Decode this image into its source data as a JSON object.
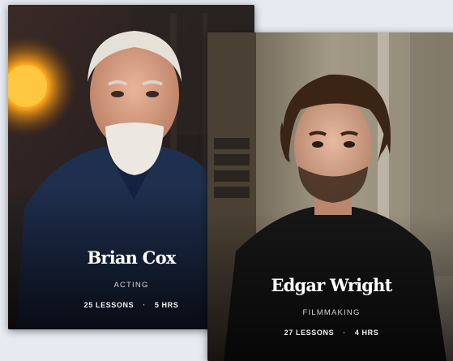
{
  "cards": [
    {
      "name": "Brian Cox",
      "category": "ACTING",
      "lessons": "25 LESSONS",
      "separator": "·",
      "duration": "5 HRS"
    },
    {
      "name": "Edgar Wright",
      "category": "FILMMAKING",
      "lessons": "27 LESSONS",
      "separator": "·",
      "duration": "4 HRS"
    }
  ],
  "colors": {
    "background": "#e6ebf2",
    "card_text": "#ffffff",
    "lamp_glow": "#f7a21c"
  }
}
